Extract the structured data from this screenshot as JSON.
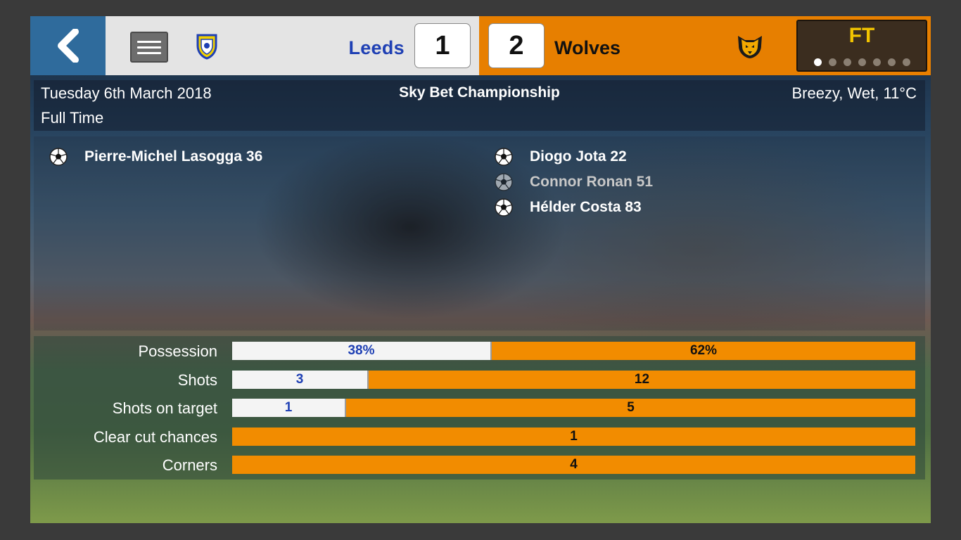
{
  "header": {
    "home_team": "Leeds",
    "home_score": "1",
    "away_team": "Wolves",
    "away_score": "2",
    "status_badge": "FT",
    "page_dots": 7,
    "active_dot": 0
  },
  "match_info": {
    "date": "Tuesday 6th March 2018",
    "status": "Full Time",
    "competition": "Sky Bet Championship",
    "weather": "Breezy, Wet, 11°C"
  },
  "goals": {
    "home": [
      {
        "text": "Pierre-Michel Lasogga 36",
        "dimmed": false
      }
    ],
    "away": [
      {
        "text": "Diogo Jota 22",
        "dimmed": false
      },
      {
        "text": "Connor Ronan 51",
        "dimmed": true
      },
      {
        "text": "Hélder Costa 83",
        "dimmed": false
      }
    ]
  },
  "stats": [
    {
      "label": "Possession",
      "home": "38%",
      "away": "62%",
      "home_value": 38,
      "away_value": 62
    },
    {
      "label": "Shots",
      "home": "3",
      "away": "12",
      "home_value": 3,
      "away_value": 12
    },
    {
      "label": "Shots on target",
      "home": "1",
      "away": "5",
      "home_value": 1,
      "away_value": 5
    },
    {
      "label": "Clear cut chances",
      "home": "",
      "away": "1",
      "home_value": 0,
      "away_value": 1
    },
    {
      "label": "Corners",
      "home": "",
      "away": "4",
      "home_value": 0,
      "away_value": 4
    }
  ],
  "colors": {
    "home_primary": "#1f40b4",
    "away_primary": "#e77f00",
    "ft_text": "#f2c400"
  },
  "icons": {
    "back": "chevron-left-icon",
    "menu": "hamburger-menu-icon",
    "goal": "football-icon",
    "home_crest": "leeds-crest-icon",
    "away_crest": "wolves-crest-icon"
  }
}
